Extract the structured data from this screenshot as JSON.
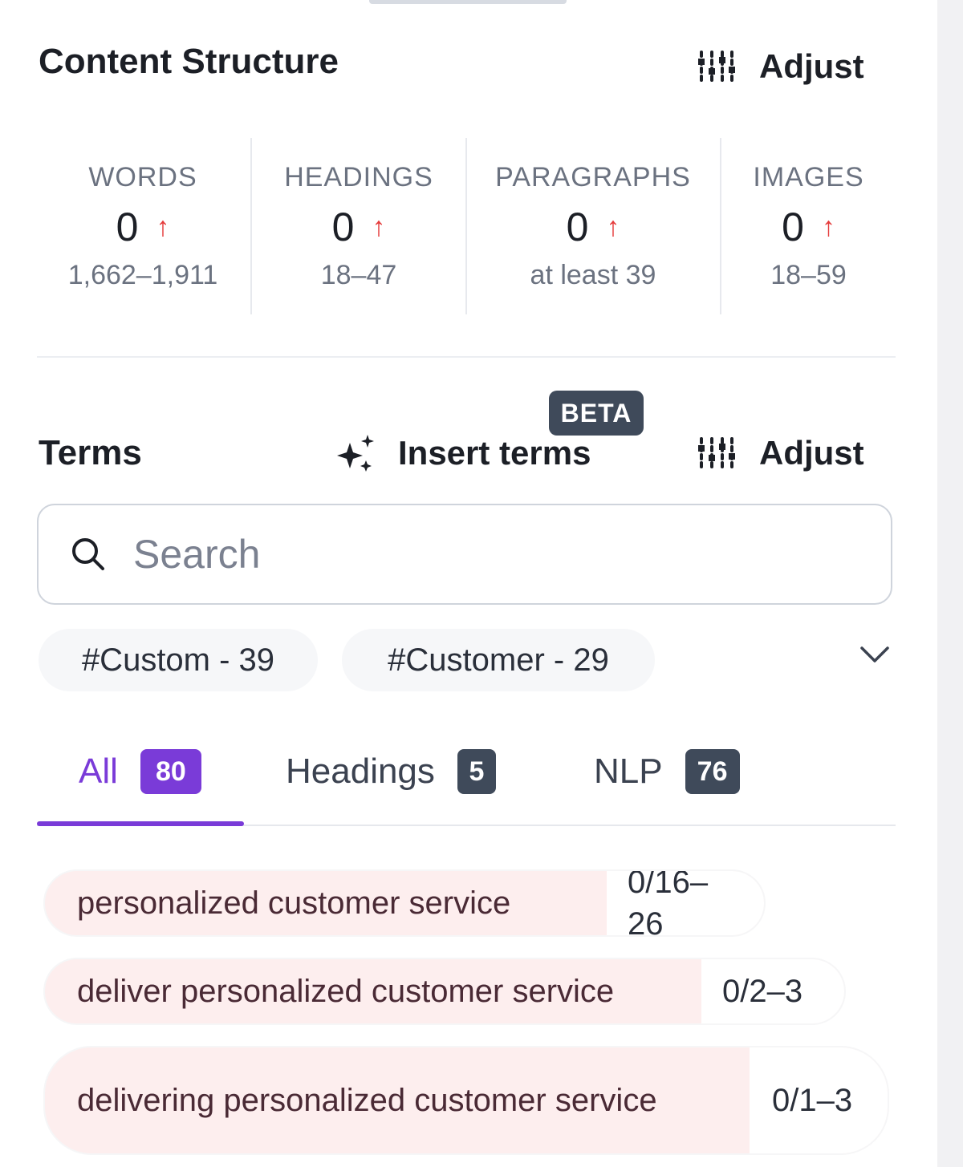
{
  "content_structure": {
    "title": "Content Structure",
    "adjust_label": "Adjust",
    "stats": [
      {
        "title": "WORDS",
        "value": "0",
        "arrow": "↑",
        "range": "1,662–1,911"
      },
      {
        "title": "HEADINGS",
        "value": "0",
        "arrow": "↑",
        "range": "18–47"
      },
      {
        "title": "PARAGRAPHS",
        "value": "0",
        "arrow": "↑",
        "range": "at least 39"
      },
      {
        "title": "IMAGES",
        "value": "0",
        "arrow": "↑",
        "range": "18–59"
      }
    ]
  },
  "terms": {
    "title": "Terms",
    "beta_label": "BETA",
    "insert_label": "Insert terms",
    "adjust_label": "Adjust",
    "search_placeholder": "Search",
    "chips": [
      "#Custom - 39",
      "#Customer - 29"
    ],
    "tabs": [
      {
        "label": "All",
        "count": "80"
      },
      {
        "label": "Headings",
        "count": "5"
      },
      {
        "label": "NLP",
        "count": "76"
      }
    ],
    "items": [
      {
        "name": "personalized customer service",
        "count": "0/16–26"
      },
      {
        "name": "deliver personalized customer service",
        "count": "0/2–3"
      },
      {
        "name": "delivering personalized customer service",
        "count": "0/1–3"
      }
    ]
  },
  "colors": {
    "accent": "#7a3bd8",
    "badge_dark": "#3f4a5a",
    "arrow_red": "#e53b3b",
    "term_bg": "#fdeeee"
  }
}
